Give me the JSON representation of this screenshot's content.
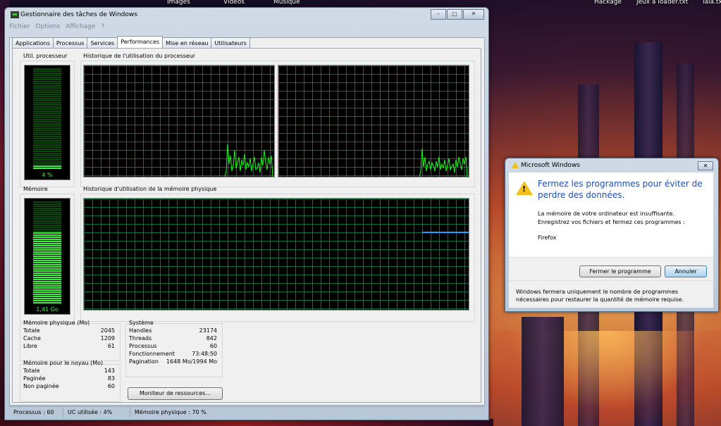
{
  "desktop": {
    "labels": [
      {
        "id": "images",
        "text": "Images"
      },
      {
        "id": "videos",
        "text": "Vidéos"
      },
      {
        "id": "musique",
        "text": "Musique"
      },
      {
        "id": "hackage",
        "text": "Hackage"
      },
      {
        "id": "jeux",
        "text": "jeux à loader.txt"
      },
      {
        "id": "lala",
        "text": "lala.txt"
      }
    ]
  },
  "taskmgr": {
    "title": "Gestionnaire des tâches de Windows",
    "menu": [
      "Fichier",
      "Options",
      "Affichage",
      "?"
    ],
    "tabs": [
      "Applications",
      "Processus",
      "Services",
      "Performances",
      "Mise en réseau",
      "Utilisateurs"
    ],
    "active_tab": "Performances",
    "cpu": {
      "usage_title": "Util. processeur",
      "usage_label": "4 %",
      "usage_fraction": 0.04,
      "history_title": "Historique de l'utilisation du processeur"
    },
    "memory": {
      "usage_title": "Mémoire",
      "usage_label": "1,41 Go",
      "usage_fraction": 0.7,
      "history_title": "Historique d'utilisation de la mémoire physique"
    },
    "physical_memory": {
      "title": "Mémoire physique (Mo)",
      "rows": [
        {
          "label": "Totale",
          "value": "2045"
        },
        {
          "label": "Cache",
          "value": "1209"
        },
        {
          "label": "Libre",
          "value": "61"
        }
      ]
    },
    "kernel_memory": {
      "title": "Mémoire pour le noyau (Mo)",
      "rows": [
        {
          "label": "Totale",
          "value": "143"
        },
        {
          "label": "Paginée",
          "value": "83"
        },
        {
          "label": "Non paginée",
          "value": "60"
        }
      ]
    },
    "system": {
      "title": "Système",
      "rows": [
        {
          "label": "Handles",
          "value": "23174"
        },
        {
          "label": "Threads",
          "value": "842"
        },
        {
          "label": "Processus",
          "value": "60"
        },
        {
          "label": "Fonctionnement",
          "value": "73:48:50"
        },
        {
          "label": "Pagination",
          "value": "1648 Mo/1994 Mo"
        }
      ]
    },
    "resource_monitor_button": "Moniteur de ressources...",
    "status": {
      "processes": "Processus : 60",
      "cpu": "UC utilisée : 4%",
      "memory": "Mémoire physique : 70 %"
    }
  },
  "dialog": {
    "title": "Microsoft Windows",
    "heading": "Fermez les programmes pour éviter de perdre des données.",
    "message": "La mémoire de votre ordinateur est insuffisante. Enregistrez vos fichiers et fermez ces programmes :",
    "program": "Firefox",
    "close_program_button": "Fermer le programme",
    "cancel_button": "Annuler",
    "footer": "Windows fermera uniquement le nombre de programmes nécessaires pour restaurer la quantité de mémoire requise."
  },
  "colors": {
    "graph_line": "#19ff19",
    "memory_line": "#1ea0ff",
    "dialog_heading": "#1a4fb0"
  }
}
